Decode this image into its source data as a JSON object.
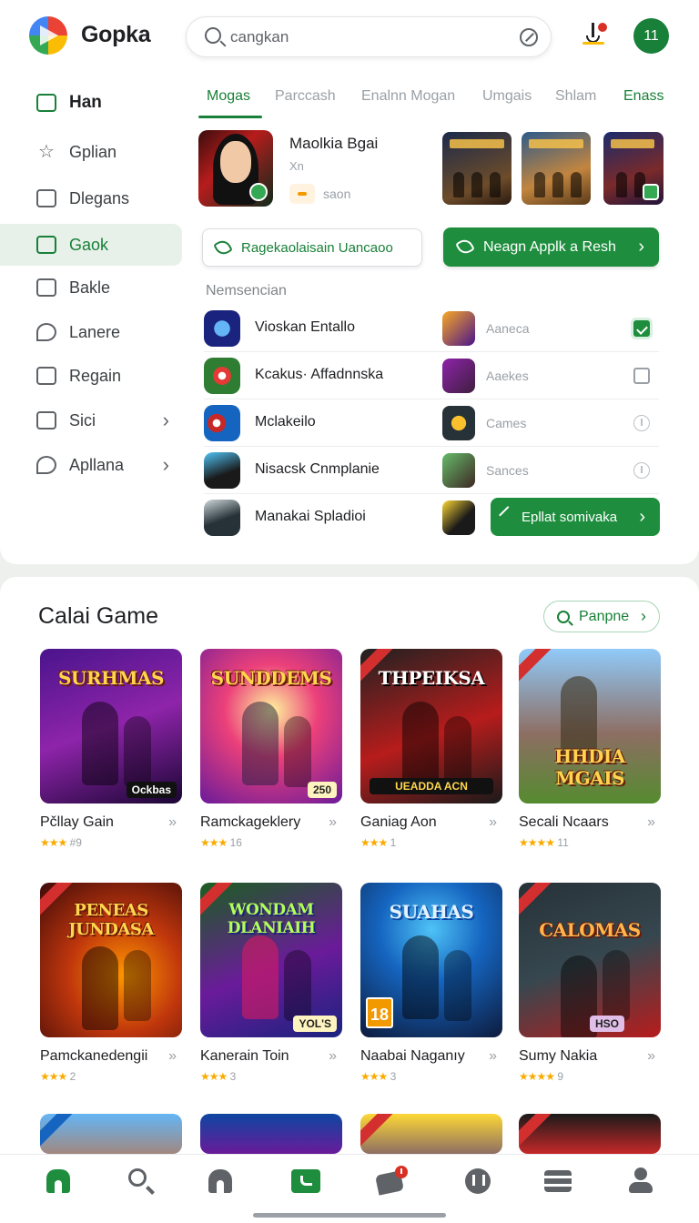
{
  "app": {
    "name": "Gopka",
    "account_badge": "11"
  },
  "search": {
    "value": "cangkan",
    "placeholder": "cangkan"
  },
  "sidebar": {
    "items": [
      {
        "label": "Han"
      },
      {
        "label": "Gplian"
      },
      {
        "label": "Dlegans"
      },
      {
        "label": "Gaok"
      },
      {
        "label": "Bakle"
      },
      {
        "label": "Lanere"
      },
      {
        "label": "Regain"
      },
      {
        "label": "Sici"
      },
      {
        "label": "Apllana"
      }
    ]
  },
  "tabs": [
    "Mogas",
    "Parccash",
    "Enalnn Mogan",
    "Umgais",
    "Shlam",
    "Enass"
  ],
  "featured": {
    "title": "Maolkia Bgai",
    "subtitle": "Xn",
    "chip": "saon"
  },
  "actions": {
    "outline_label": "Ragekaolaisain Uancaoo",
    "primary_label": "Neagn Applk a Resh"
  },
  "list": {
    "heading": "Nemsencian",
    "rows": [
      {
        "name": "Vioskan Entallo",
        "category": "Aaneca"
      },
      {
        "name": "Kcakus· Affadnnska",
        "category": "Aaekes"
      },
      {
        "name": "Mclakeilo",
        "category": "Cames"
      },
      {
        "name": "Nisacsk Cnmplanie",
        "category": "Sances"
      },
      {
        "name": "Manakai Spladioi",
        "button_label": "Epllat somivaka"
      }
    ]
  },
  "games_section": {
    "title": "Calai Game",
    "action_label": "Panpne",
    "cards": [
      {
        "title": "Pčllay Gain",
        "art_text": "SURHMAS",
        "tag": "Ockbas",
        "rating": "#9"
      },
      {
        "title": "Ramckageklery",
        "art_text": "SUNDDEMS",
        "tag": "250",
        "rating": "16"
      },
      {
        "title": "Ganiag Aon",
        "art_text": "THPEIKSA",
        "tag": "UEADDA ACN",
        "rating": "1"
      },
      {
        "title": "Secali Ncaars",
        "art_text": "HHDIA MGAIS",
        "rating": "11"
      },
      {
        "title": "Pamckanedengii",
        "art_text": "PENEAS JUNDASA",
        "rating": "2"
      },
      {
        "title": "Kanerain Toin",
        "art_text": "WONDAM DLANIAIH",
        "tag": "YOL'S",
        "rating": "3"
      },
      {
        "title": "Naabai Naganıy",
        "art_text": "SUAHAS",
        "age": "18",
        "rating": "3"
      },
      {
        "title": "Sumy Nakia",
        "art_text": "CALOMAS",
        "tag": "HSO",
        "rating": "9"
      }
    ]
  },
  "colors": {
    "accent": "#188038",
    "primary": "#1e8e3e"
  },
  "nav": {
    "icons": [
      "home-icon",
      "search-icon",
      "house-icon",
      "store-icon",
      "chat-icon",
      "award-icon",
      "library-icon",
      "profile-icon"
    ]
  }
}
